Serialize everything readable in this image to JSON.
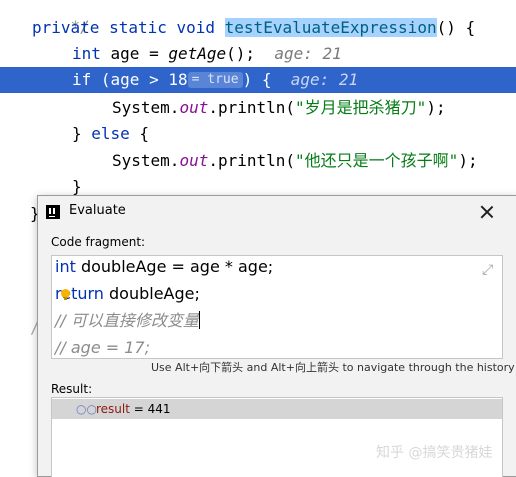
{
  "editor": {
    "line0_comment": "*/",
    "line1": {
      "kw": "private static void ",
      "method": "testEvaluateExpression",
      "rest": "() {"
    },
    "line2": {
      "kw": "int",
      "code": " age = ",
      "call": "getAge",
      "rest": "();",
      "hint": "age: 21"
    },
    "line3": {
      "kw": "if",
      "code": " (age > 18",
      "inline_value": "= true",
      "rest": ") {",
      "hint": "age: 21"
    },
    "line4": {
      "code1": "System.",
      "field": "out",
      "code2": ".println(",
      "str": "\"岁月是把杀猪刀\"",
      "end": ");"
    },
    "line5": {
      "code1": "} ",
      "kw": "else",
      "code2": " {"
    },
    "line6": {
      "code1": "System.",
      "field": "out",
      "code2": ".println(",
      "str": "\"他还只是一个孩子啊\"",
      "end": ");"
    },
    "line7": "}",
    "gutter_chars": [
      "}",
      "p",
      "/"
    ]
  },
  "dialog": {
    "title": "Evaluate",
    "code_fragment_label": "Code fragment:",
    "code_lines": [
      {
        "kw": "int",
        "code": " doubleAge = age * age;"
      },
      {
        "kw": "return",
        "code": " doubleAge;"
      },
      {
        "comment": "// 可以直接修改变量"
      },
      {
        "comment": "// age = 17;"
      }
    ],
    "nav_hint": "Use Alt+向下箭头 and Alt+向上箭头 to navigate through the history",
    "result_label": "Result:",
    "result": {
      "icon": "glasses-icon",
      "name": "result",
      "op": " = ",
      "value": "441"
    }
  },
  "watermark": "知乎 @搞笑贵猪娃",
  "colors": {
    "selection_line": "#2f65ca",
    "keyword": "#0033b3",
    "string": "#067d17",
    "field": "#871094"
  }
}
